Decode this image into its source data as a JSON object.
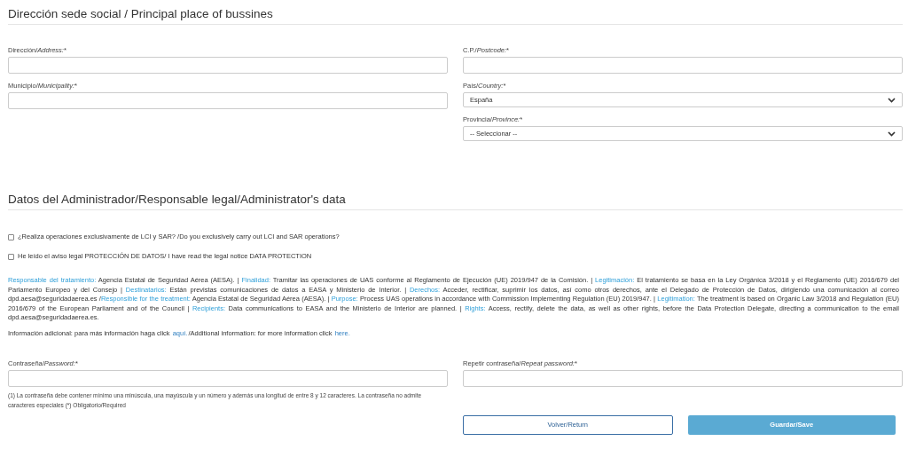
{
  "sections": [
    {
      "title": "Dirección sede social / Principal place of bussines"
    },
    {
      "title": "Datos del Administrador/Responsable legal/Administrator's data"
    }
  ],
  "address_fields": {
    "left": [
      {
        "kind": "input",
        "label": "Dirección/*Address:*",
        "required_mark": "*"
      },
      {
        "kind": "input",
        "label": "Municipio/*Municipality:*",
        "required_mark": "*"
      }
    ],
    "right": [
      {
        "kind": "input",
        "label": "C.P./*Postcode:*",
        "required_mark": "*"
      },
      {
        "kind": "select",
        "label": "País/*Country:*",
        "required_mark": "*",
        "value": "España"
      },
      {
        "kind": "select",
        "label": "Provincia/*Province:*",
        "required_mark": "*",
        "value": "-- Seleccionar --"
      }
    ]
  },
  "checkboxes": [
    {
      "label": "¿Realiza operaciones exclusivamente de LCI y SAR? /Do you exclusively carry out LCI and SAR operations?",
      "checked": false
    },
    {
      "label": "He leído el aviso legal PROTECCIÓN DE DATOS/ I have read the legal notice DATA PROTECTION",
      "checked": false
    }
  ],
  "legal_notice": [
    {
      "kind": "term",
      "text": "Responsable del tratamiento:"
    },
    {
      "kind": "body",
      "text": " Agencia Estatal de Seguridad Aérea (AESA). | "
    },
    {
      "kind": "term",
      "text": "Finalidad:"
    },
    {
      "kind": "body",
      "text": " Tramitar las operaciones de UAS conforme al Reglamento de Ejecución (UE) 2019/947 de la Comisión. | "
    },
    {
      "kind": "term",
      "text": "Legitimación:"
    },
    {
      "kind": "body",
      "text": " El tratamiento se basa en la Ley Orgánica 3/2018 y el Reglamento (UE) 2016/679 del Parlamento Europeo y del Consejo | "
    },
    {
      "kind": "term",
      "text": "Destinatarios:"
    },
    {
      "kind": "body",
      "text": " Están previstas comunicaciones de datos a EASA y Ministerio de Interior. | "
    },
    {
      "kind": "term",
      "text": "Derechos:"
    },
    {
      "kind": "body",
      "text": " Acceder, rectificar, suprimir los datos, así como otros derechos, ante el Delegado de Protección de Datos, dirigiendo una comunicación al correo dpd.aesa@seguridadaerea.es /"
    },
    {
      "kind": "term",
      "text": "Responsible for the treatment:"
    },
    {
      "kind": "body",
      "text": " Agencia Estatal de Seguridad Aérea (AESA). | "
    },
    {
      "kind": "term",
      "text": "Purpose:"
    },
    {
      "kind": "body",
      "text": " Process UAS operations in accordance with Commission Implementing Regulation (EU) 2019/947. | "
    },
    {
      "kind": "term",
      "text": "Legitimation:"
    },
    {
      "kind": "body",
      "text": " The treatment is based on Organic Law 3/2018 and Regulation (EU) 2016/679 of the European Parliament and of the Council | "
    },
    {
      "kind": "term",
      "text": "Recipients:"
    },
    {
      "kind": "body",
      "text": " Data communications to EASA and the Ministerio de Interior are planned. | "
    },
    {
      "kind": "term",
      "text": "Rights:"
    },
    {
      "kind": "body",
      "text": " Access, rectify, delete the data, as well as other rights, before the Data Protection Delegate, directing a communication to the email dpd.aesa@seguridadaerea.es."
    }
  ],
  "additional_info": [
    {
      "kind": "text",
      "text": "Información adicional: para más información haga click "
    },
    {
      "kind": "link",
      "text": "aquí."
    },
    {
      "kind": "text",
      "text": "/Additional information: for more information click "
    },
    {
      "kind": "link",
      "text": "here."
    }
  ],
  "password_fields": [
    {
      "label": "Contraseña/*Password:*",
      "required_mark": "*",
      "hint": "(1) La contraseña debe contener mínimo una minúscula, una mayúscula y un número y además una longitud de entre 8 y 12 caracteres. La contraseña no admite caracteres especiales (*) Obligatorio/Required"
    },
    {
      "label": "Repetir contraseña/*Repeat password:*",
      "required_mark": "*"
    }
  ],
  "buttons": [
    {
      "label": "Volver/Return",
      "kind": "secondary"
    },
    {
      "label": "Guardar/Save",
      "kind": "primary"
    }
  ]
}
